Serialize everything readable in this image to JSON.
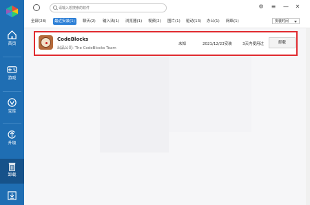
{
  "sidebar": {
    "items": [
      {
        "label": "首页",
        "icon": "home-icon"
      },
      {
        "label": "游戏",
        "icon": "gamepad-icon"
      },
      {
        "label": "宝库",
        "icon": "treasure-icon"
      },
      {
        "label": "升级",
        "icon": "upgrade-icon"
      },
      {
        "label": "卸载",
        "icon": "trash-icon",
        "active": true
      },
      {
        "label": "",
        "icon": "download-icon"
      }
    ]
  },
  "search": {
    "placeholder": "请输入想搜索的软件"
  },
  "window_controls": [
    "settings-icon",
    "menu-icon",
    "minimize-icon",
    "close-icon"
  ],
  "categories": [
    {
      "label": "全部(28)"
    },
    {
      "label": "最近安装(1)",
      "active": true
    },
    {
      "label": "聊天(2)"
    },
    {
      "label": "输入法(1)"
    },
    {
      "label": "浏览器(1)"
    },
    {
      "label": "视频(2)"
    },
    {
      "label": "图片(1)"
    },
    {
      "label": "驱动(13)"
    },
    {
      "label": "办公(1)"
    },
    {
      "label": "网络(1)"
    }
  ],
  "sort": {
    "value": "安装时间"
  },
  "app_row": {
    "name": "CodeBlocks",
    "publisher": "出品公司: The CodeBlocks Team",
    "size": "未知",
    "install_date": "2021/12/23安装",
    "usage": "3天内使用过",
    "action_label": "卸载"
  },
  "colors": {
    "sidebar": "#1f6eb3",
    "accent": "#2d7fd6",
    "highlight_border": "#e02a2f"
  }
}
